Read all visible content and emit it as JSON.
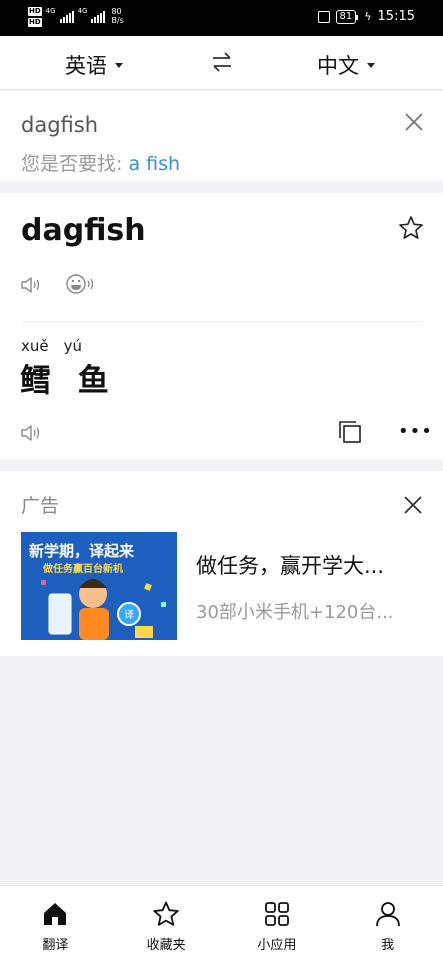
{
  "status_bar": {
    "hd1": "HD",
    "hd2": "HD",
    "net1": "4G",
    "net2": "4G",
    "speed_value": "80",
    "speed_unit": "B/s",
    "battery": "81",
    "time": "15:15"
  },
  "lang_bar": {
    "source": "英语",
    "target": "中文"
  },
  "input": {
    "query": "dagfish",
    "suggest_prefix": "您是否要找: ",
    "suggest_link": "a fish"
  },
  "result": {
    "word": "dagfish",
    "pinyin": [
      "xuě",
      "yú"
    ],
    "translation": "鳕 鱼"
  },
  "ad": {
    "label": "广告",
    "image_title": "新学期，译起来",
    "image_subtitle": "做任务赢百台新机",
    "title": "做任务，赢开学大...",
    "subtitle": "30部小米手机+120台..."
  },
  "bottom_nav": {
    "items": [
      {
        "label": "翻译",
        "icon": "home-icon"
      },
      {
        "label": "收藏夹",
        "icon": "star-icon"
      },
      {
        "label": "小应用",
        "icon": "grid-icon"
      },
      {
        "label": "我",
        "icon": "user-icon"
      }
    ]
  },
  "colors": {
    "link": "#3a8fd8",
    "ad_image_bg": "#1d5fbf"
  }
}
